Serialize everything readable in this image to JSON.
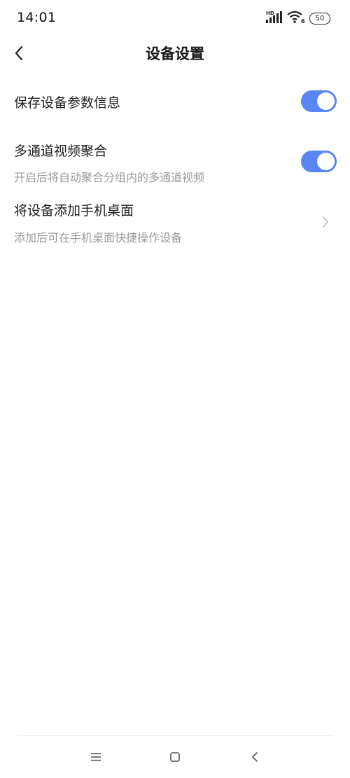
{
  "status_bar": {
    "time": "14:01",
    "signal_label": "HD",
    "wifi_label": "6",
    "battery_level": "50"
  },
  "header": {
    "title": "设备设置"
  },
  "settings": [
    {
      "title": "保存设备参数信息",
      "control": "toggle",
      "enabled": true
    },
    {
      "title": "多通道视频聚合",
      "subtitle": "开启后将自动聚合分组内的多通道视频",
      "control": "toggle",
      "enabled": true
    },
    {
      "title": "将设备添加手机桌面",
      "subtitle": "添加后可在手机桌面快捷操作设备",
      "control": "chevron"
    }
  ],
  "colors": {
    "toggle_on": "#5a86f5",
    "subtitle_text": "#9a9a9a",
    "title_text": "#222222"
  },
  "navigation": {
    "icons": [
      "menu-icon",
      "home-icon",
      "back-icon"
    ]
  }
}
